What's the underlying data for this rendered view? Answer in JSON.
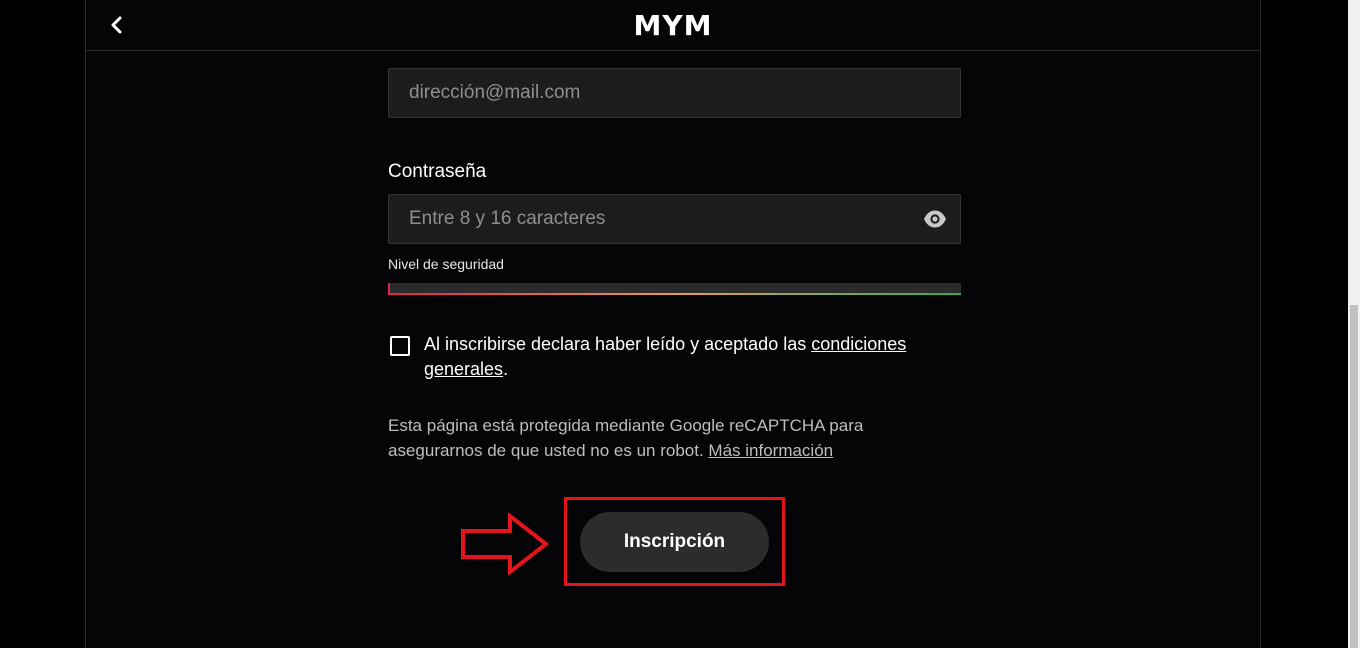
{
  "header": {
    "logo": "MYM"
  },
  "form": {
    "email_field": {
      "placeholder": "dirección@mail.com"
    },
    "password": {
      "label": "Contraseña",
      "placeholder": "Entre 8 y 16 caracteres"
    },
    "security_level_label": "Nivel de seguridad",
    "terms": {
      "text": "Al inscribirse declara haber leído y aceptado las ",
      "link": "condiciones generales",
      "suffix": "."
    },
    "captcha": {
      "text": "Esta página está protegida mediante Google reCAPTCHA para asegurarnos de que usted no es un robot. ",
      "link": "Más información"
    },
    "submit_label": "Inscripción"
  },
  "colors": {
    "background": "#000000",
    "panel": "#050507",
    "field": "#1c1c1e",
    "button": "#2c2c2f",
    "highlight": "#e3141c"
  },
  "icons": [
    "chevron-left-icon",
    "eye-icon",
    "right-arrow-annotation-icon"
  ]
}
